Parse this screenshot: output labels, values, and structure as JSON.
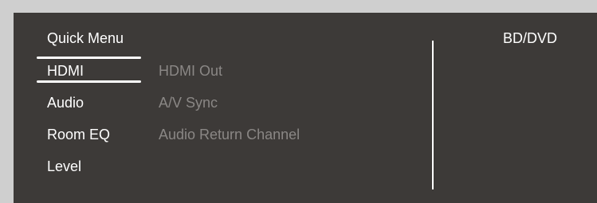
{
  "quick_menu": {
    "title": "Quick Menu",
    "source": "BD/DVD",
    "items": [
      {
        "label": "HDMI"
      },
      {
        "label": "Audio"
      },
      {
        "label": "Room EQ"
      },
      {
        "label": "Level"
      }
    ],
    "selected_index": 0,
    "submenu": [
      {
        "label": "HDMI Out"
      },
      {
        "label": "A/V Sync"
      },
      {
        "label": "Audio Return Channel"
      }
    ]
  },
  "colors": {
    "background": "#cfcfcf",
    "panel": "#3d3a38",
    "active_text": "#ffffff",
    "inactive_text": "#8a8785",
    "selection": "#ffffff"
  }
}
